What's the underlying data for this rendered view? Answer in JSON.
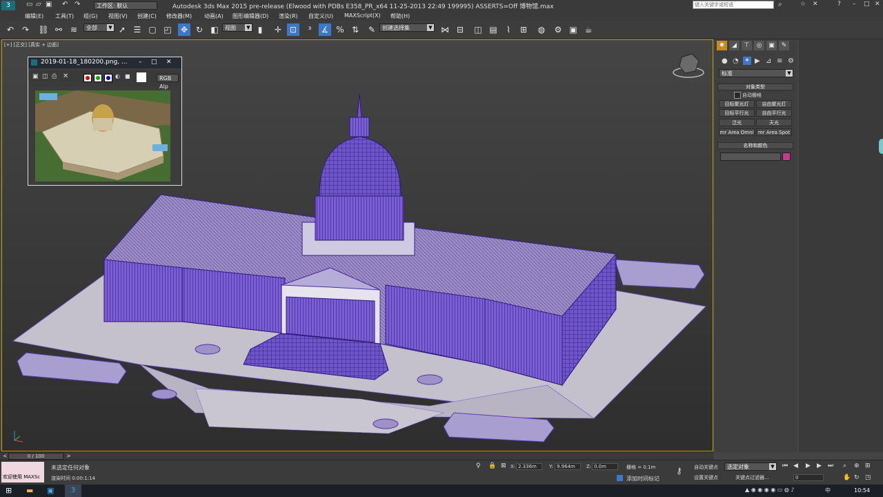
{
  "titlebar": {
    "workspace_label": "工作区: 默认",
    "title": "Autodesk 3ds Max  2015 pre-release (Elwood with PDBs E358_PR_x64 11-25-2013 22:49 199995) ASSERTS=Off    博物馆.max",
    "search_placeholder": "键入关键字或短语"
  },
  "menu": [
    "编辑(E)",
    "工具(T)",
    "组(G)",
    "视图(V)",
    "创建(C)",
    "修改器(M)",
    "动画(A)",
    "图形编辑器(D)",
    "渲染(R)",
    "自定义(U)",
    "MAXScript(X)",
    "帮助(H)"
  ],
  "toolbar": {
    "filter_value": "全部",
    "coord_value": "视图",
    "selection_set_placeholder": "创建选择集"
  },
  "viewport": {
    "label": "[+] [正交] [真实 + 边面]"
  },
  "floating_window": {
    "title": "2019-01-18_180200.png, ...",
    "channel_value": "RGB Alp"
  },
  "command_panel": {
    "category_value": "标准",
    "object_type_header": "对象类型",
    "autogrid_label": "自动栅格",
    "buttons": [
      "目标聚光灯",
      "自由聚光灯",
      "目标平行光",
      "自由平行光",
      "泛光",
      "天光",
      "mr Area Omni",
      "mr Area Spot"
    ],
    "name_color_header": "名称和颜色",
    "swatch_color": "#c43c8c"
  },
  "trackbar": {
    "frame_label": "0 / 100"
  },
  "status": {
    "maxscript_label": "欢迎使用 MAXSc",
    "selection_status": "未选定任何对象",
    "render_time": "渲染时间 0:00:1:14",
    "x_value": "2.336m",
    "y_value": "9.964m",
    "z_value": "0.0m",
    "grid_label": "栅格 = 0.1m",
    "auto_key_label": "自动关键点",
    "set_key_label": "设置关键点",
    "selected_dropdown": "选定对象",
    "key_filters_label": "关键点过滤器...",
    "add_time_tag": "添加时间标记",
    "frame_field": "0"
  },
  "taskbar": {
    "clock": "10:54",
    "ime": "中"
  }
}
